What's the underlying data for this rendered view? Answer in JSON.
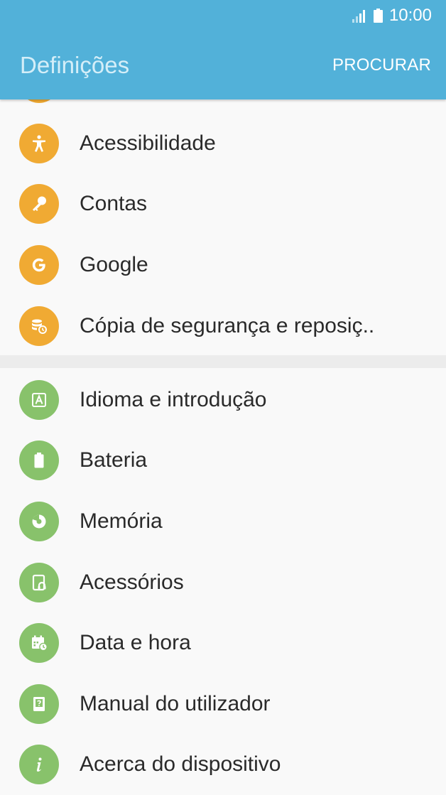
{
  "status": {
    "time": "10:00"
  },
  "appbar": {
    "title": "Definições",
    "search_label": "PROCURAR"
  },
  "colors": {
    "appbar": "#52b1d9",
    "orange": "#f0aa33",
    "green": "#88c26b"
  },
  "group1": [
    {
      "label": "Acessibilidade",
      "icon": "accessibility-icon"
    },
    {
      "label": "Contas",
      "icon": "key-icon"
    },
    {
      "label": "Google",
      "icon": "google-icon"
    },
    {
      "label": "Cópia de segurança e reposiç..",
      "icon": "backup-icon"
    }
  ],
  "group2": [
    {
      "label": "Idioma e introdução",
      "icon": "language-icon"
    },
    {
      "label": "Bateria",
      "icon": "battery-icon"
    },
    {
      "label": "Memória",
      "icon": "storage-icon"
    },
    {
      "label": "Acessórios",
      "icon": "accessories-icon"
    },
    {
      "label": "Data e hora",
      "icon": "calendar-clock-icon"
    },
    {
      "label": "Manual do utilizador",
      "icon": "user-manual-icon"
    },
    {
      "label": "Acerca do dispositivo",
      "icon": "info-icon"
    }
  ]
}
